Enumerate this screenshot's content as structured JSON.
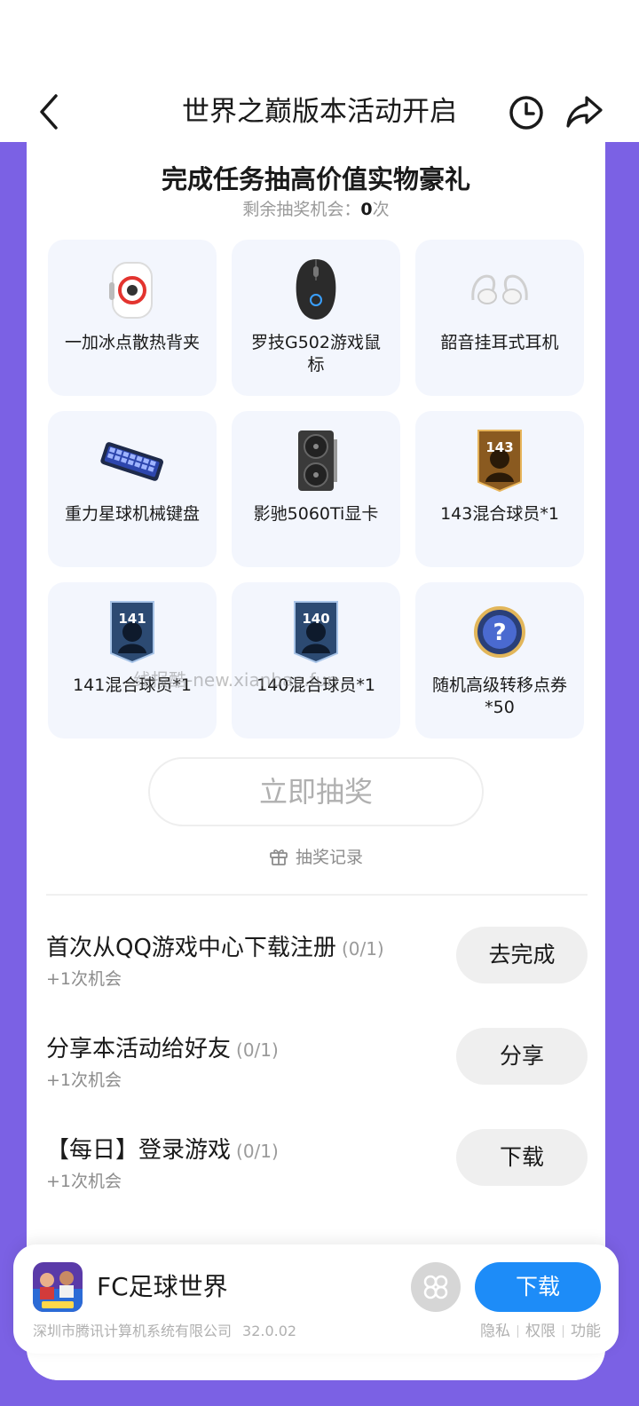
{
  "header": {
    "title": "世界之巅版本活动开启",
    "back_icon": "chevron-left-icon",
    "history_icon": "clock-icon",
    "share_icon": "share-arrow-icon"
  },
  "lottery": {
    "title": "完成任务抽高价值实物豪礼",
    "remaining_label": "剩余抽奖机会：",
    "remaining_count": "0",
    "remaining_unit": "次",
    "prizes": [
      {
        "label": "一加冰点散热背夹",
        "icon": "cooling-fan-clip-icon"
      },
      {
        "label": "罗技G502游戏鼠标",
        "icon": "gaming-mouse-icon"
      },
      {
        "label": "韶音挂耳式耳机",
        "icon": "earbuds-icon"
      },
      {
        "label": "重力星球机械键盘",
        "icon": "keyboard-icon"
      },
      {
        "label": "影驰5060Ti显卡",
        "icon": "graphics-card-icon"
      },
      {
        "label": "143混合球员*1",
        "icon": "player-card-143-icon",
        "rating": "143"
      },
      {
        "label": "141混合球员*1",
        "icon": "player-card-141-icon",
        "rating": "141"
      },
      {
        "label": "140混合球员*1",
        "icon": "player-card-140-icon",
        "rating": "140"
      },
      {
        "label": "随机高级转移点券*50",
        "icon": "mystery-coin-icon",
        "glyph": "?"
      }
    ],
    "draw_button": "立即抽奖",
    "record_label": "抽奖记录"
  },
  "watermark": "线报酷-new.xianbao.fun",
  "tasks": [
    {
      "title": "首次从QQ游戏中心下载注册",
      "progress": "(0/1)",
      "reward": "+1次机会",
      "button": "去完成"
    },
    {
      "title": "分享本活动给好友",
      "progress": "(0/1)",
      "reward": "+1次机会",
      "button": "分享"
    },
    {
      "title": "【每日】登录游戏",
      "progress": "(0/1)",
      "reward": "+1次机会",
      "button": "下载"
    }
  ],
  "app_card": {
    "name": "FC足球世界",
    "publisher": "深圳市腾讯计算机系统有限公司",
    "version": "32.0.02",
    "download_button": "下载",
    "links": [
      "隐私",
      "权限",
      "功能"
    ]
  },
  "colors": {
    "background_purple": "#7b61e4",
    "download_blue": "#1d8cf8",
    "card_bg": "#f3f6fd"
  }
}
